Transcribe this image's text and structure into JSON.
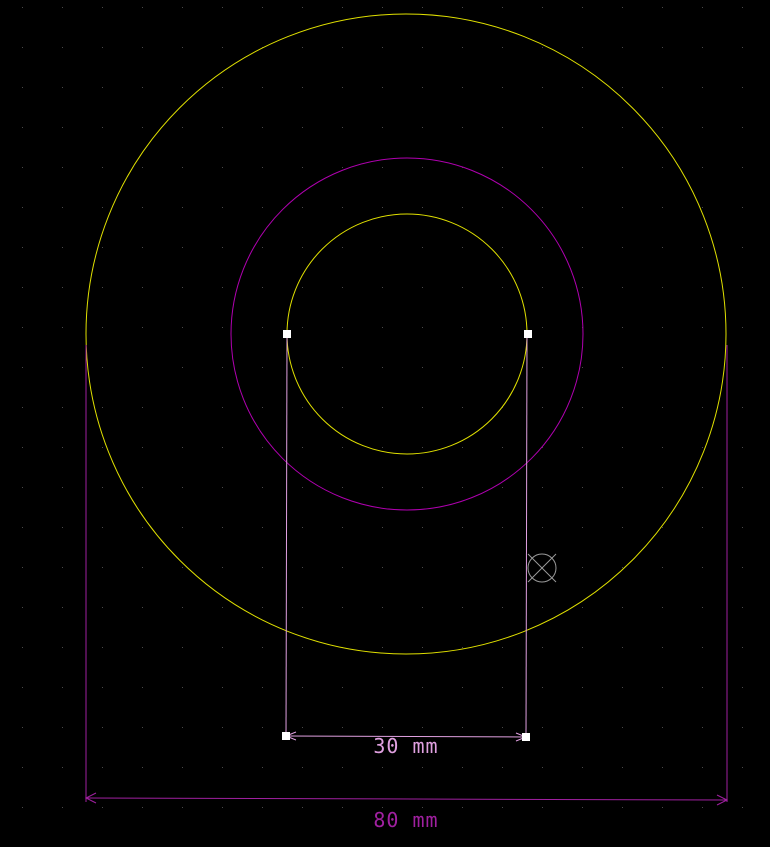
{
  "colors": {
    "background": "#000000",
    "grid_dot": "#4a4a4a",
    "outline_yellow": "#e0e000",
    "outline_magenta": "#b000b0",
    "dimension_30": "#e0a0e0",
    "dimension_80": "#a020a0",
    "handle": "#ffffff",
    "anchor_marker": "#9a9a9a"
  },
  "dimensions": {
    "inner": {
      "value_label": "30 mm"
    },
    "outer": {
      "value_label": "80 mm"
    }
  },
  "icons": {
    "anchor": "crossed-circle-icon",
    "handle": "square-handle-icon"
  }
}
